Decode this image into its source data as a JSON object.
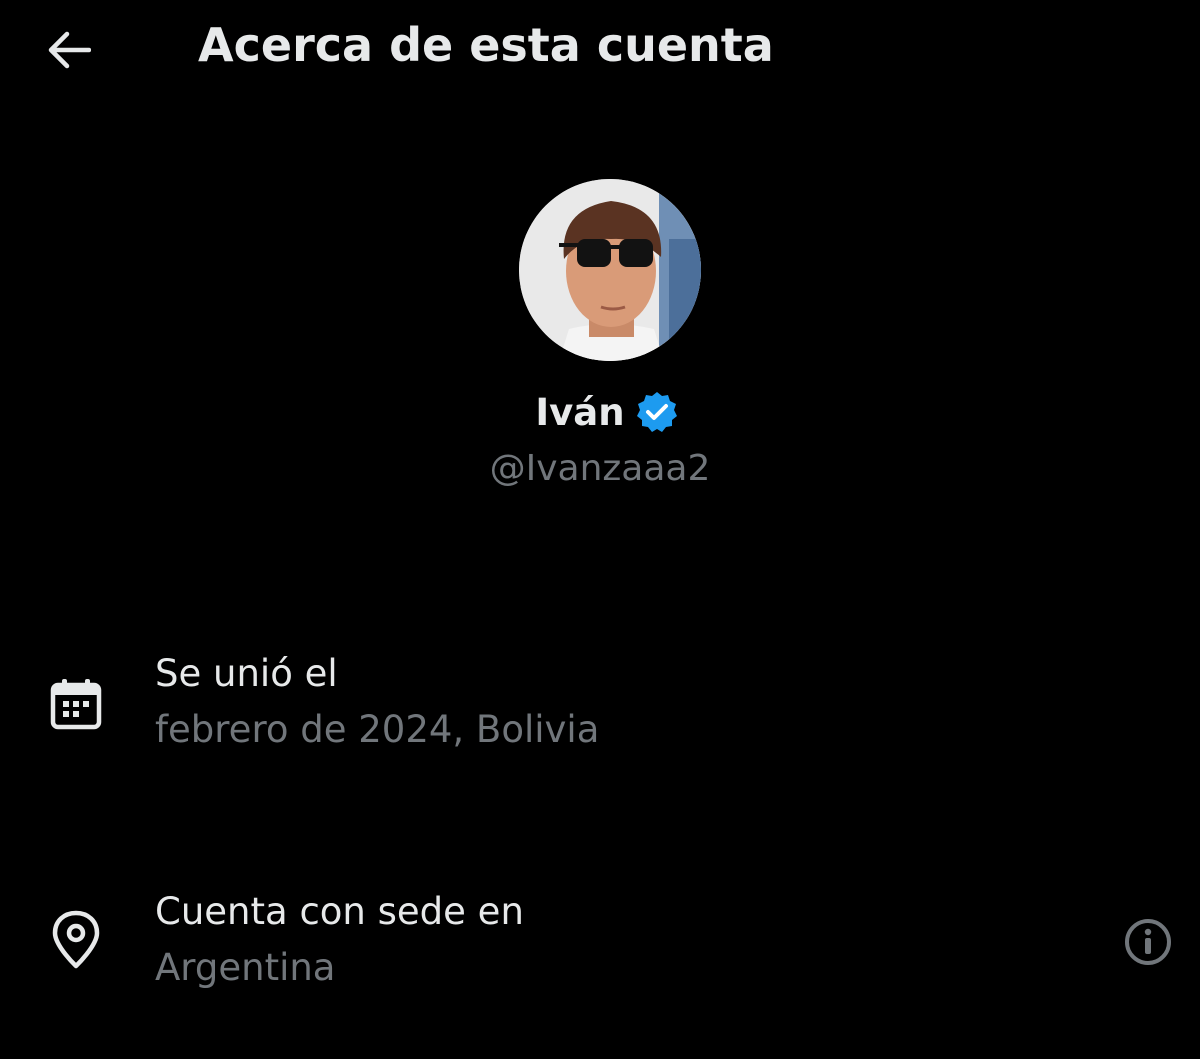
{
  "header": {
    "title": "Acerca de esta cuenta",
    "back_icon": "arrow-left-icon"
  },
  "profile": {
    "display_name": "Iván",
    "handle": "@Ivanzaaa2",
    "verified_icon": "verified-badge-icon",
    "verified_color": "#1d9bf0"
  },
  "rows": [
    {
      "icon": "calendar-icon",
      "title": "Se unió el",
      "value": "febrero de 2024, Bolivia"
    },
    {
      "icon": "location-pin-icon",
      "title": "Cuenta con sede en",
      "value": "Argentina",
      "info_icon": "info-icon"
    }
  ],
  "colors": {
    "background": "#000000",
    "primary_text": "#e7e9ea",
    "secondary_text": "#71767b"
  }
}
